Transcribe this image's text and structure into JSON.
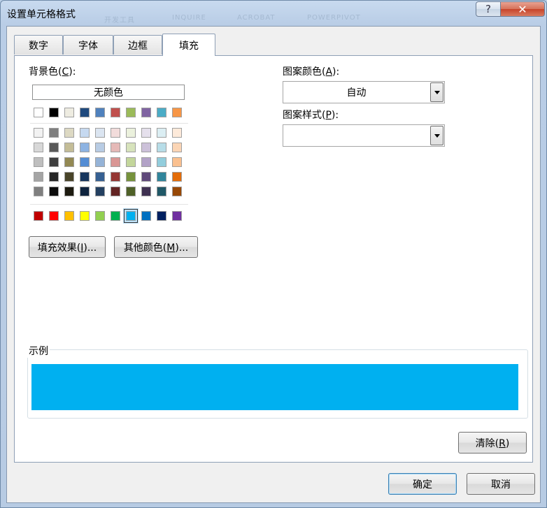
{
  "window": {
    "title": "设置单元格格式",
    "help_glyph": "?",
    "close_glyph": "✕",
    "background_ghost": [
      "开发工具",
      "INQUIRE",
      "ACROBAT",
      "POWERPIVOT"
    ]
  },
  "tabs": [
    {
      "label": "数字",
      "active": false
    },
    {
      "label": "字体",
      "active": false
    },
    {
      "label": "边框",
      "active": false
    },
    {
      "label": "填充",
      "active": true
    }
  ],
  "background_color": {
    "label": "背景色(C):",
    "no_color_label": "无颜色",
    "theme_row": [
      "#ffffff",
      "#000000",
      "#eeece1",
      "#1f497d",
      "#4f81bd",
      "#c0504d",
      "#9bbb59",
      "#8064a2",
      "#4bacc6",
      "#f79646"
    ],
    "tint_rows": [
      [
        "#f2f2f2",
        "#7f7f7f",
        "#ddd9c3",
        "#c6d9f0",
        "#dbe5f1",
        "#f2dcdb",
        "#ebf1dd",
        "#e5e0ec",
        "#dbeef3",
        "#fdeada"
      ],
      [
        "#d8d8d8",
        "#595959",
        "#c4bd97",
        "#8db3e2",
        "#b8cce4",
        "#e5b9b7",
        "#d7e3bc",
        "#ccc1d9",
        "#b7dde8",
        "#fbd5b5"
      ],
      [
        "#bfbfbf",
        "#3f3f3f",
        "#938953",
        "#548dd4",
        "#95b3d7",
        "#d99694",
        "#c3d69b",
        "#b2a2c7",
        "#92cddc",
        "#fac08f"
      ],
      [
        "#a5a5a5",
        "#262626",
        "#494429",
        "#17365d",
        "#366092",
        "#953734",
        "#76923c",
        "#5f497a",
        "#31859b",
        "#e36c09"
      ],
      [
        "#7f7f7f",
        "#0c0c0c",
        "#1d1b10",
        "#0f243e",
        "#244061",
        "#632423",
        "#4f6128",
        "#3f3151",
        "#205867",
        "#974806"
      ]
    ],
    "standard_row": [
      "#c00000",
      "#ff0000",
      "#ffc000",
      "#ffff00",
      "#92d050",
      "#00b050",
      "#00b0f0",
      "#0070c0",
      "#002060",
      "#7030a0"
    ],
    "selected_standard_index": 6,
    "fill_effects_label": "填充效果(I)...",
    "more_colors_label": "其他颜色(M)..."
  },
  "pattern": {
    "color_label": "图案颜色(A):",
    "color_value": "自动",
    "style_label": "图案样式(P):",
    "style_value": ""
  },
  "sample": {
    "label": "示例",
    "fill_color": "#00b0f0"
  },
  "buttons": {
    "clear": "清除(R)",
    "ok": "确定",
    "cancel": "取消"
  }
}
